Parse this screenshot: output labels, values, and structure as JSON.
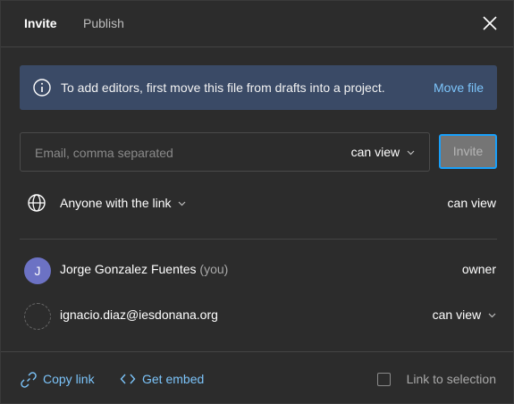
{
  "tabs": [
    {
      "label": "Invite",
      "active": true
    },
    {
      "label": "Publish",
      "active": false
    }
  ],
  "banner": {
    "icon": "info-icon",
    "message": "To add editors, first move this file from drafts into a project.",
    "action_label": "Move file"
  },
  "invite": {
    "placeholder": "Email, comma separated",
    "value": "",
    "permission": "can view",
    "button_label": "Invite"
  },
  "link_access": {
    "icon": "globe-icon",
    "label": "Anyone with the link",
    "permission": "can view"
  },
  "people": [
    {
      "initial": "J",
      "name": "Jorge Gonzalez Fuentes",
      "suffix": "(you)",
      "role": "owner"
    },
    {
      "initial": "",
      "name": "ignacio.diaz@iesdonana.org",
      "suffix": "",
      "role": "can view"
    }
  ],
  "footer": {
    "copy_link_label": "Copy link",
    "get_embed_label": "Get embed",
    "link_to_selection_label": "Link to selection",
    "link_to_selection_checked": false
  },
  "colors": {
    "background": "#2c2c2c",
    "banner": "#3a4a66",
    "link": "#7cc4fa",
    "accent": "#18a0fb",
    "avatar": "#6c72c4"
  }
}
